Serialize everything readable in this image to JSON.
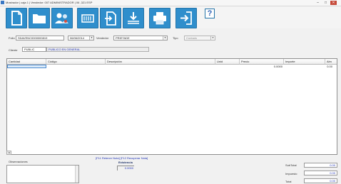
{
  "window": {
    "title": "Mostrador  |  caja 1  |  Vendedor: 007  ADMINISTRADOR | 06 ,321  ESP",
    "buttons": {
      "minimize": "–",
      "maximize": "□",
      "close": "✕"
    }
  },
  "toolbar": {
    "help": "?"
  },
  "form": {
    "folio_label": "Folio",
    "folio_value": "SDAVENC0000000819",
    "date_value": "06/06/2014",
    "vendedor_label": "Vendedor",
    "vendedor_value": "PRIETADE",
    "tipo_label": "Tipo",
    "tipo_value": "Contado",
    "cliente_label": "Cliente",
    "cliente_code": "PUBLIC",
    "cliente_name": "PUBLICO EN GENERAL"
  },
  "grid": {
    "columns": [
      "Cantidad",
      "Código",
      "Descripción",
      "Unid",
      "Precio",
      "Importe",
      "Alm"
    ],
    "row": {
      "precio": "0.0000",
      "importe": "0.00"
    }
  },
  "footer": {
    "hotkeys": "[F11 Retener Nota]  [F12 Recuperar Nota]",
    "observaciones_label": "Observaciones",
    "existencia_label": "Existencia",
    "existencia_value": "0.0000",
    "subtotal_label": "SubTotal",
    "subtotal_value": "0.00",
    "impuesto_label": "Impuesto",
    "impuesto_value": "0.00",
    "total_label": "Total",
    "total_value": "0.00"
  },
  "colors": {
    "toolbar_button": "#2f8ecc",
    "link_text": "#2336b8",
    "header_bg": "#f4f4f4"
  }
}
